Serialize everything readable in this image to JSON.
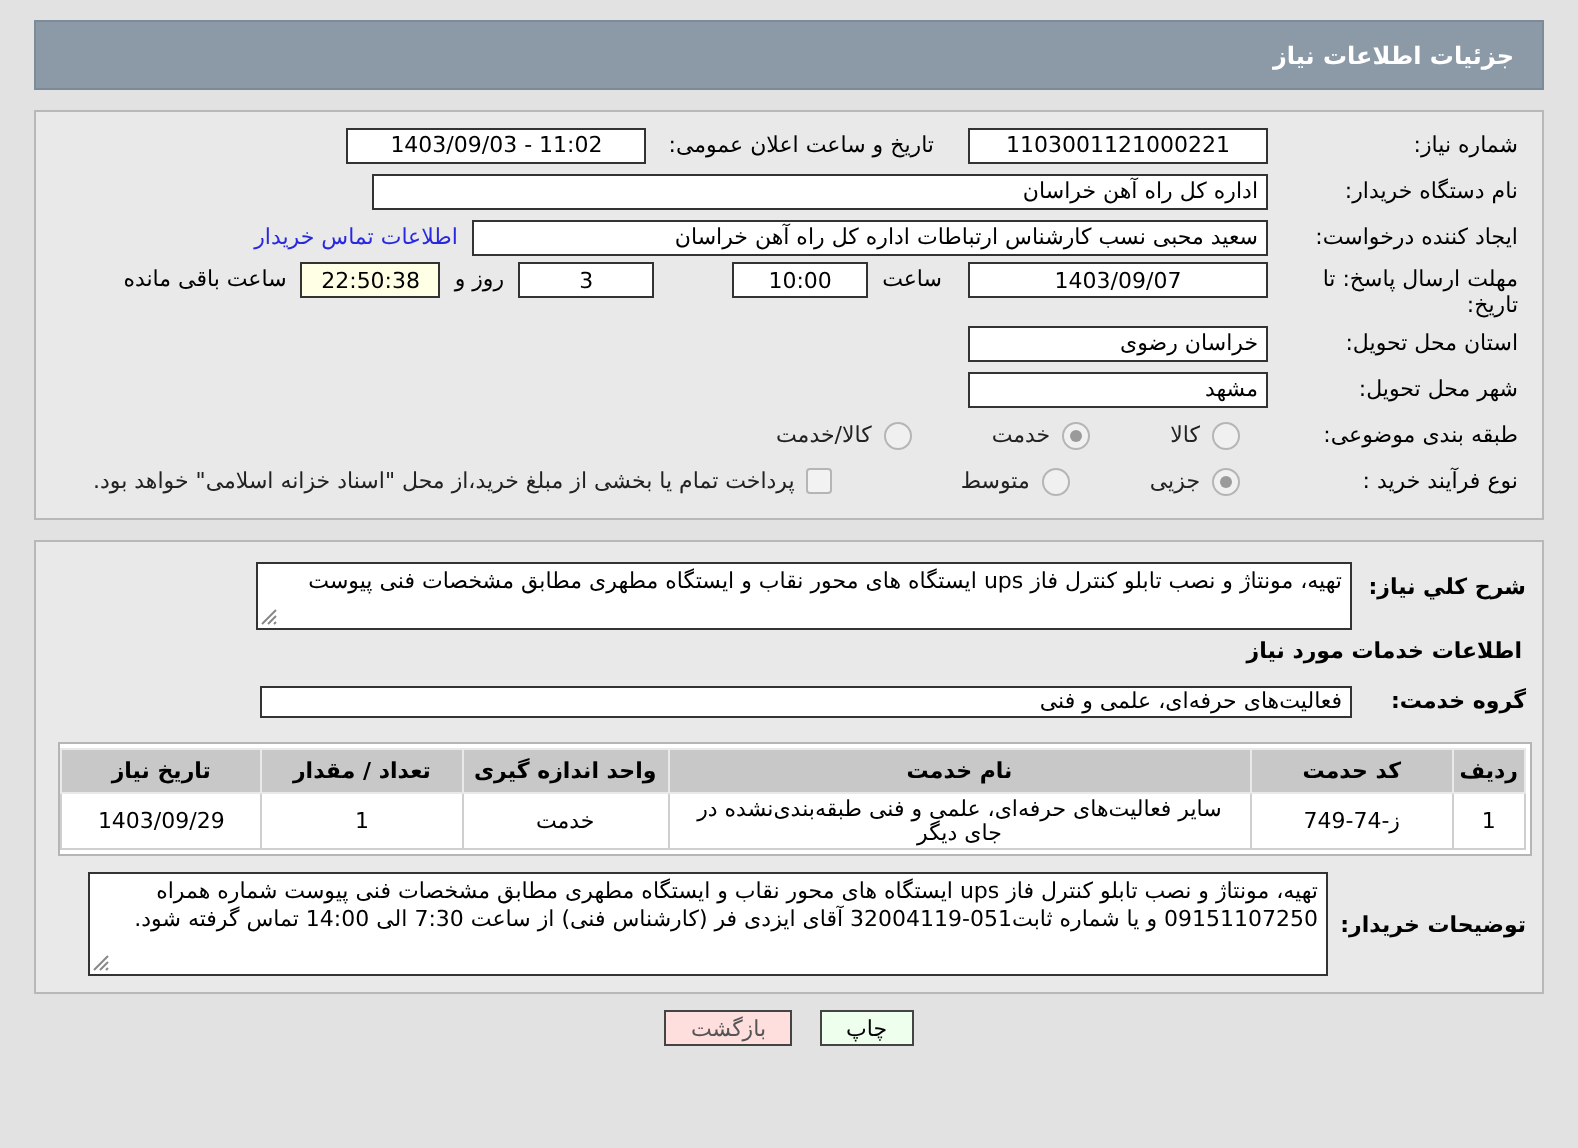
{
  "header": {
    "title": "جزئیات اطلاعات نیاز"
  },
  "details": {
    "need_number": {
      "label": "شماره نیاز:",
      "value": "1103001121000221"
    },
    "announce": {
      "label": "تاریخ و ساعت اعلان عمومی:",
      "value": "1403/09/03 - 11:02"
    },
    "buyer": {
      "label": "نام دستگاه خریدار:",
      "value": "اداره کل راه آهن خراسان"
    },
    "creator": {
      "label": "ایجاد کننده درخواست:",
      "value": "سعید محبی نسب کارشناس ارتباطات اداره کل راه آهن خراسان",
      "link": "اطلاعات تماس خریدار"
    },
    "deadline": {
      "label": "مهلت ارسال پاسخ: تا تاریخ:",
      "date": "1403/09/07",
      "time_label": "ساعت",
      "time": "10:00",
      "days": "3",
      "days_label": "روز و",
      "remaining": "22:50:38",
      "remaining_label": "ساعت باقی مانده"
    },
    "province": {
      "label": "استان محل تحویل:",
      "value": "خراسان رضوی"
    },
    "city": {
      "label": "شهر محل تحویل:",
      "value": "مشهد"
    },
    "category": {
      "label": "طبقه بندی موضوعی:",
      "options": [
        {
          "label": "کالا",
          "selected": false
        },
        {
          "label": "خدمت",
          "selected": true
        },
        {
          "label": "کالا/خدمت",
          "selected": false
        }
      ]
    },
    "process": {
      "label": "نوع فرآیند خرید :",
      "options": [
        {
          "label": "جزیی",
          "selected": true
        },
        {
          "label": "متوسط",
          "selected": false
        }
      ],
      "payment": {
        "label": "پرداخت تمام یا بخشی از مبلغ خرید،از محل \"اسناد خزانه اسلامی\" خواهد بود.",
        "checked": false
      }
    }
  },
  "need": {
    "description": {
      "label": "شرح كلي نياز:",
      "value": "تهیه، مونتاژ و نصب تابلو کنترل فاز ups ایستگاه های محور نقاب و ایستگاه مطهری مطابق مشخصات فنی پیوست"
    },
    "services_title": "اطلاعات خدمات مورد نیاز",
    "service_group": {
      "label": "گروه خدمت:",
      "value": "فعالیت‌های حرفه‌ای، علمی و فنی"
    },
    "table": {
      "columns": [
        "ردیف",
        "کد حدمت",
        "نام خدمت",
        "واحد اندازه گیری",
        "تعداد / مقدار",
        "تاریخ نیاز"
      ],
      "rows": [
        [
          "1",
          "ز-74-749",
          "سایر فعالیت‌های حرفه‌ای، علمی و فنی طبقه‌بندی‌نشده در جای دیگر",
          "خدمت",
          "1",
          "1403/09/29"
        ]
      ]
    },
    "buyer_notes": {
      "label": "توضیحات خریدار:",
      "value": "تهیه، مونتاژ و نصب تابلو کنترل فاز ups ایستگاه های محور نقاب و ایستگاه مطهری مطابق مشخصات فنی پیوست شماره همراه 09151107250 و یا شماره ثابت051-32004119 آقای ایزدی فر (کارشناس فنی) از ساعت 7:30 الی 14:00 تماس گرفته شود."
    }
  },
  "buttons": [
    {
      "label": "چاپ",
      "kind": "print"
    },
    {
      "label": "بازگشت",
      "kind": "back"
    }
  ]
}
